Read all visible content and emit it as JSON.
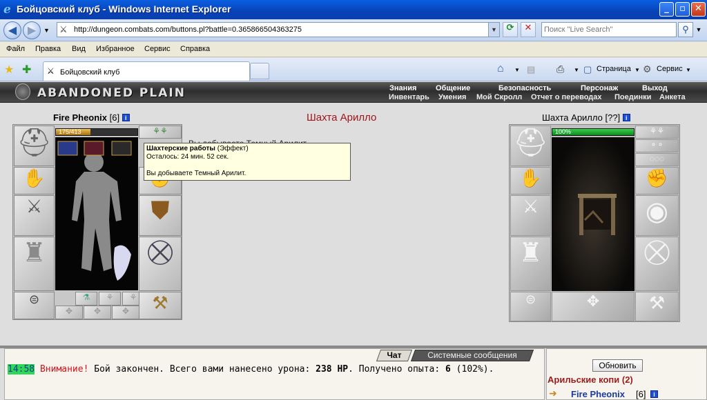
{
  "window": {
    "title": "Бойцовский клуб - Windows Internet Explorer"
  },
  "address_bar": {
    "url": "http://dungeon.combats.com/buttons.pl?battle=0.365866504363275",
    "search_placeholder": "Поиск \"Live Search\""
  },
  "menu": [
    "Файл",
    "Правка",
    "Вид",
    "Избранное",
    "Сервис",
    "Справка"
  ],
  "tab": {
    "title": "Бойцовский клуб"
  },
  "commands": {
    "page": "Страница",
    "service": "Сервис"
  },
  "game": {
    "logo": "ABANDONED PLAIN",
    "nav_row1": [
      "Знания",
      "Общение",
      "Безопасность",
      "Персонаж",
      "Выход"
    ],
    "nav_row2": [
      "Инвентарь",
      "Умения",
      "Мой Скролл",
      "Отчет о переводах",
      "Поединки",
      "Анкета"
    ]
  },
  "character": {
    "name": "Fire Pheonix",
    "level": "[6]",
    "hp_text": "175/413",
    "hp_fraction": 0.424
  },
  "location": {
    "title": "Шахта Арилло",
    "background_message": "Вы добываете Темный Арилит.",
    "mine_name": "Шахта Арилло",
    "mine_level": "[??]",
    "mine_hp_text": "100%",
    "mine_hp_fraction": 1.0
  },
  "tooltip": {
    "title": "Шахтерские работы",
    "type": "(Эффект)",
    "remaining": "Осталось: 24 мин. 52 сек.",
    "message": "Вы добываете Темный Арилит."
  },
  "chat": {
    "tab_chat": "Чат",
    "tab_system": "Системные сообщения",
    "time": "14:58",
    "warning": "Внимание!",
    "text_1": " Бой закончен. Всего вами нанесено урона: ",
    "damage": "238 HP",
    "text_2": ". Получено опыта: ",
    "exp": "6",
    "text_3": " (102%)."
  },
  "players": {
    "refresh_button": "Обновить",
    "location": "Арильские копи (2)",
    "player_name": "Fire Pheonix",
    "player_level": "[6]"
  },
  "colors": {
    "accent_red": "#a0141a",
    "chat_time_bg": "#2ed856",
    "link_blue": "#1a3aa0"
  }
}
